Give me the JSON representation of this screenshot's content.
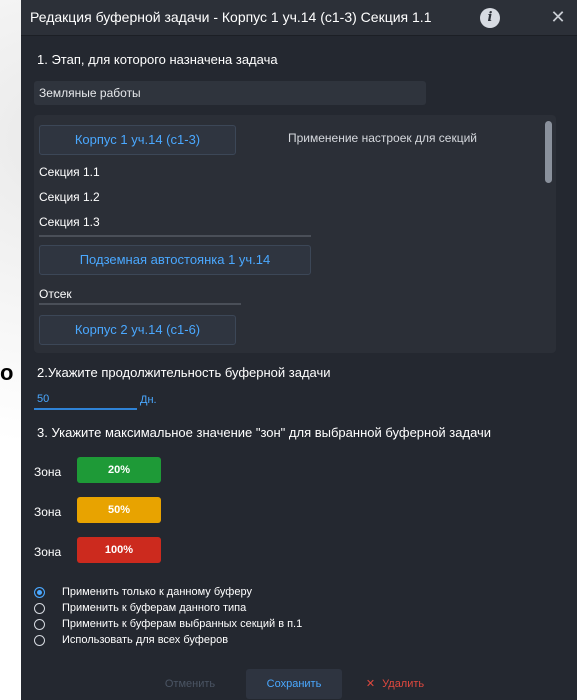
{
  "background": {
    "partial_letter": "о"
  },
  "dialog": {
    "title": "Редакция буферной задачи - Корпус 1 уч.14 (с1-3) Секция 1.1",
    "info_icon": "info-icon",
    "close_icon": "close-icon",
    "close_glyph": "✕"
  },
  "stage": {
    "label": "1. Этап, для которого назначена задача",
    "value": "Земляные работы"
  },
  "sections_panel": {
    "apply_label": "Применение настроек для секций",
    "groups": [
      {
        "label": "Корпус 1 уч.14 (с1-3)",
        "items": [
          "Секция 1.1",
          "Секция 1.2",
          "Секция 1.3"
        ]
      },
      {
        "label": "Подземная автостоянка 1 уч.14",
        "items": [
          "Отсек"
        ]
      },
      {
        "label": "Корпус 2 уч.14 (с1-6)",
        "items": []
      }
    ]
  },
  "duration": {
    "label": "2.Укажите продолжительность буферной задачи",
    "value": "50",
    "unit": "Дн."
  },
  "zones": {
    "label": "3. Укажите максимальное значение \"зон\" для выбранной буферной задачи",
    "items": [
      {
        "label": "Зона",
        "value": "20%",
        "color": "#1e9a37"
      },
      {
        "label": "Зона",
        "value": "50%",
        "color": "#e8a300"
      },
      {
        "label": "Зона",
        "value": "100%",
        "color": "#cc2a1e"
      }
    ]
  },
  "apply_options": {
    "selected": 0,
    "options": [
      "Применить только к данному буферу",
      "Применить к буферам данного типа",
      "Применить к буферам выбранных секций в п.1",
      "Использовать для всех буферов"
    ]
  },
  "footer": {
    "cancel_label": "Отменить",
    "save_label": "Сохранить",
    "delete_label": "Удалить",
    "delete_glyph": "✕",
    "colors": {
      "cancel": "#4b5564",
      "save": "#4aa8ff",
      "delete": "#e0483e",
      "save_bg": "#2e3440"
    }
  }
}
